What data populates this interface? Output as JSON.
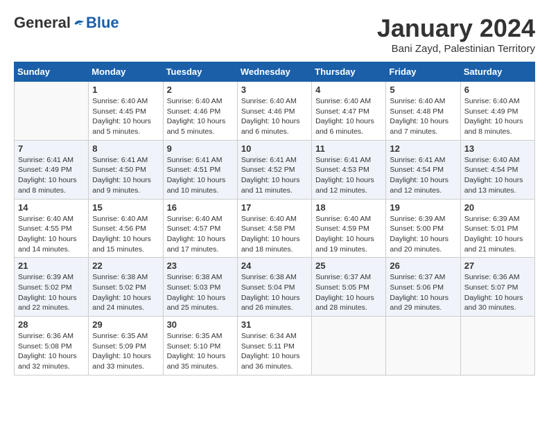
{
  "header": {
    "logo_general": "General",
    "logo_blue": "Blue",
    "month_title": "January 2024",
    "location": "Bani Zayd, Palestinian Territory"
  },
  "days_of_week": [
    "Sunday",
    "Monday",
    "Tuesday",
    "Wednesday",
    "Thursday",
    "Friday",
    "Saturday"
  ],
  "weeks": [
    [
      {
        "day": "",
        "info": ""
      },
      {
        "day": "1",
        "info": "Sunrise: 6:40 AM\nSunset: 4:45 PM\nDaylight: 10 hours\nand 5 minutes."
      },
      {
        "day": "2",
        "info": "Sunrise: 6:40 AM\nSunset: 4:46 PM\nDaylight: 10 hours\nand 5 minutes."
      },
      {
        "day": "3",
        "info": "Sunrise: 6:40 AM\nSunset: 4:46 PM\nDaylight: 10 hours\nand 6 minutes."
      },
      {
        "day": "4",
        "info": "Sunrise: 6:40 AM\nSunset: 4:47 PM\nDaylight: 10 hours\nand 6 minutes."
      },
      {
        "day": "5",
        "info": "Sunrise: 6:40 AM\nSunset: 4:48 PM\nDaylight: 10 hours\nand 7 minutes."
      },
      {
        "day": "6",
        "info": "Sunrise: 6:40 AM\nSunset: 4:49 PM\nDaylight: 10 hours\nand 8 minutes."
      }
    ],
    [
      {
        "day": "7",
        "info": "Sunrise: 6:41 AM\nSunset: 4:49 PM\nDaylight: 10 hours\nand 8 minutes."
      },
      {
        "day": "8",
        "info": "Sunrise: 6:41 AM\nSunset: 4:50 PM\nDaylight: 10 hours\nand 9 minutes."
      },
      {
        "day": "9",
        "info": "Sunrise: 6:41 AM\nSunset: 4:51 PM\nDaylight: 10 hours\nand 10 minutes."
      },
      {
        "day": "10",
        "info": "Sunrise: 6:41 AM\nSunset: 4:52 PM\nDaylight: 10 hours\nand 11 minutes."
      },
      {
        "day": "11",
        "info": "Sunrise: 6:41 AM\nSunset: 4:53 PM\nDaylight: 10 hours\nand 12 minutes."
      },
      {
        "day": "12",
        "info": "Sunrise: 6:41 AM\nSunset: 4:54 PM\nDaylight: 10 hours\nand 12 minutes."
      },
      {
        "day": "13",
        "info": "Sunrise: 6:40 AM\nSunset: 4:54 PM\nDaylight: 10 hours\nand 13 minutes."
      }
    ],
    [
      {
        "day": "14",
        "info": "Sunrise: 6:40 AM\nSunset: 4:55 PM\nDaylight: 10 hours\nand 14 minutes."
      },
      {
        "day": "15",
        "info": "Sunrise: 6:40 AM\nSunset: 4:56 PM\nDaylight: 10 hours\nand 15 minutes."
      },
      {
        "day": "16",
        "info": "Sunrise: 6:40 AM\nSunset: 4:57 PM\nDaylight: 10 hours\nand 17 minutes."
      },
      {
        "day": "17",
        "info": "Sunrise: 6:40 AM\nSunset: 4:58 PM\nDaylight: 10 hours\nand 18 minutes."
      },
      {
        "day": "18",
        "info": "Sunrise: 6:40 AM\nSunset: 4:59 PM\nDaylight: 10 hours\nand 19 minutes."
      },
      {
        "day": "19",
        "info": "Sunrise: 6:39 AM\nSunset: 5:00 PM\nDaylight: 10 hours\nand 20 minutes."
      },
      {
        "day": "20",
        "info": "Sunrise: 6:39 AM\nSunset: 5:01 PM\nDaylight: 10 hours\nand 21 minutes."
      }
    ],
    [
      {
        "day": "21",
        "info": "Sunrise: 6:39 AM\nSunset: 5:02 PM\nDaylight: 10 hours\nand 22 minutes."
      },
      {
        "day": "22",
        "info": "Sunrise: 6:38 AM\nSunset: 5:02 PM\nDaylight: 10 hours\nand 24 minutes."
      },
      {
        "day": "23",
        "info": "Sunrise: 6:38 AM\nSunset: 5:03 PM\nDaylight: 10 hours\nand 25 minutes."
      },
      {
        "day": "24",
        "info": "Sunrise: 6:38 AM\nSunset: 5:04 PM\nDaylight: 10 hours\nand 26 minutes."
      },
      {
        "day": "25",
        "info": "Sunrise: 6:37 AM\nSunset: 5:05 PM\nDaylight: 10 hours\nand 28 minutes."
      },
      {
        "day": "26",
        "info": "Sunrise: 6:37 AM\nSunset: 5:06 PM\nDaylight: 10 hours\nand 29 minutes."
      },
      {
        "day": "27",
        "info": "Sunrise: 6:36 AM\nSunset: 5:07 PM\nDaylight: 10 hours\nand 30 minutes."
      }
    ],
    [
      {
        "day": "28",
        "info": "Sunrise: 6:36 AM\nSunset: 5:08 PM\nDaylight: 10 hours\nand 32 minutes."
      },
      {
        "day": "29",
        "info": "Sunrise: 6:35 AM\nSunset: 5:09 PM\nDaylight: 10 hours\nand 33 minutes."
      },
      {
        "day": "30",
        "info": "Sunrise: 6:35 AM\nSunset: 5:10 PM\nDaylight: 10 hours\nand 35 minutes."
      },
      {
        "day": "31",
        "info": "Sunrise: 6:34 AM\nSunset: 5:11 PM\nDaylight: 10 hours\nand 36 minutes."
      },
      {
        "day": "",
        "info": ""
      },
      {
        "day": "",
        "info": ""
      },
      {
        "day": "",
        "info": ""
      }
    ]
  ]
}
